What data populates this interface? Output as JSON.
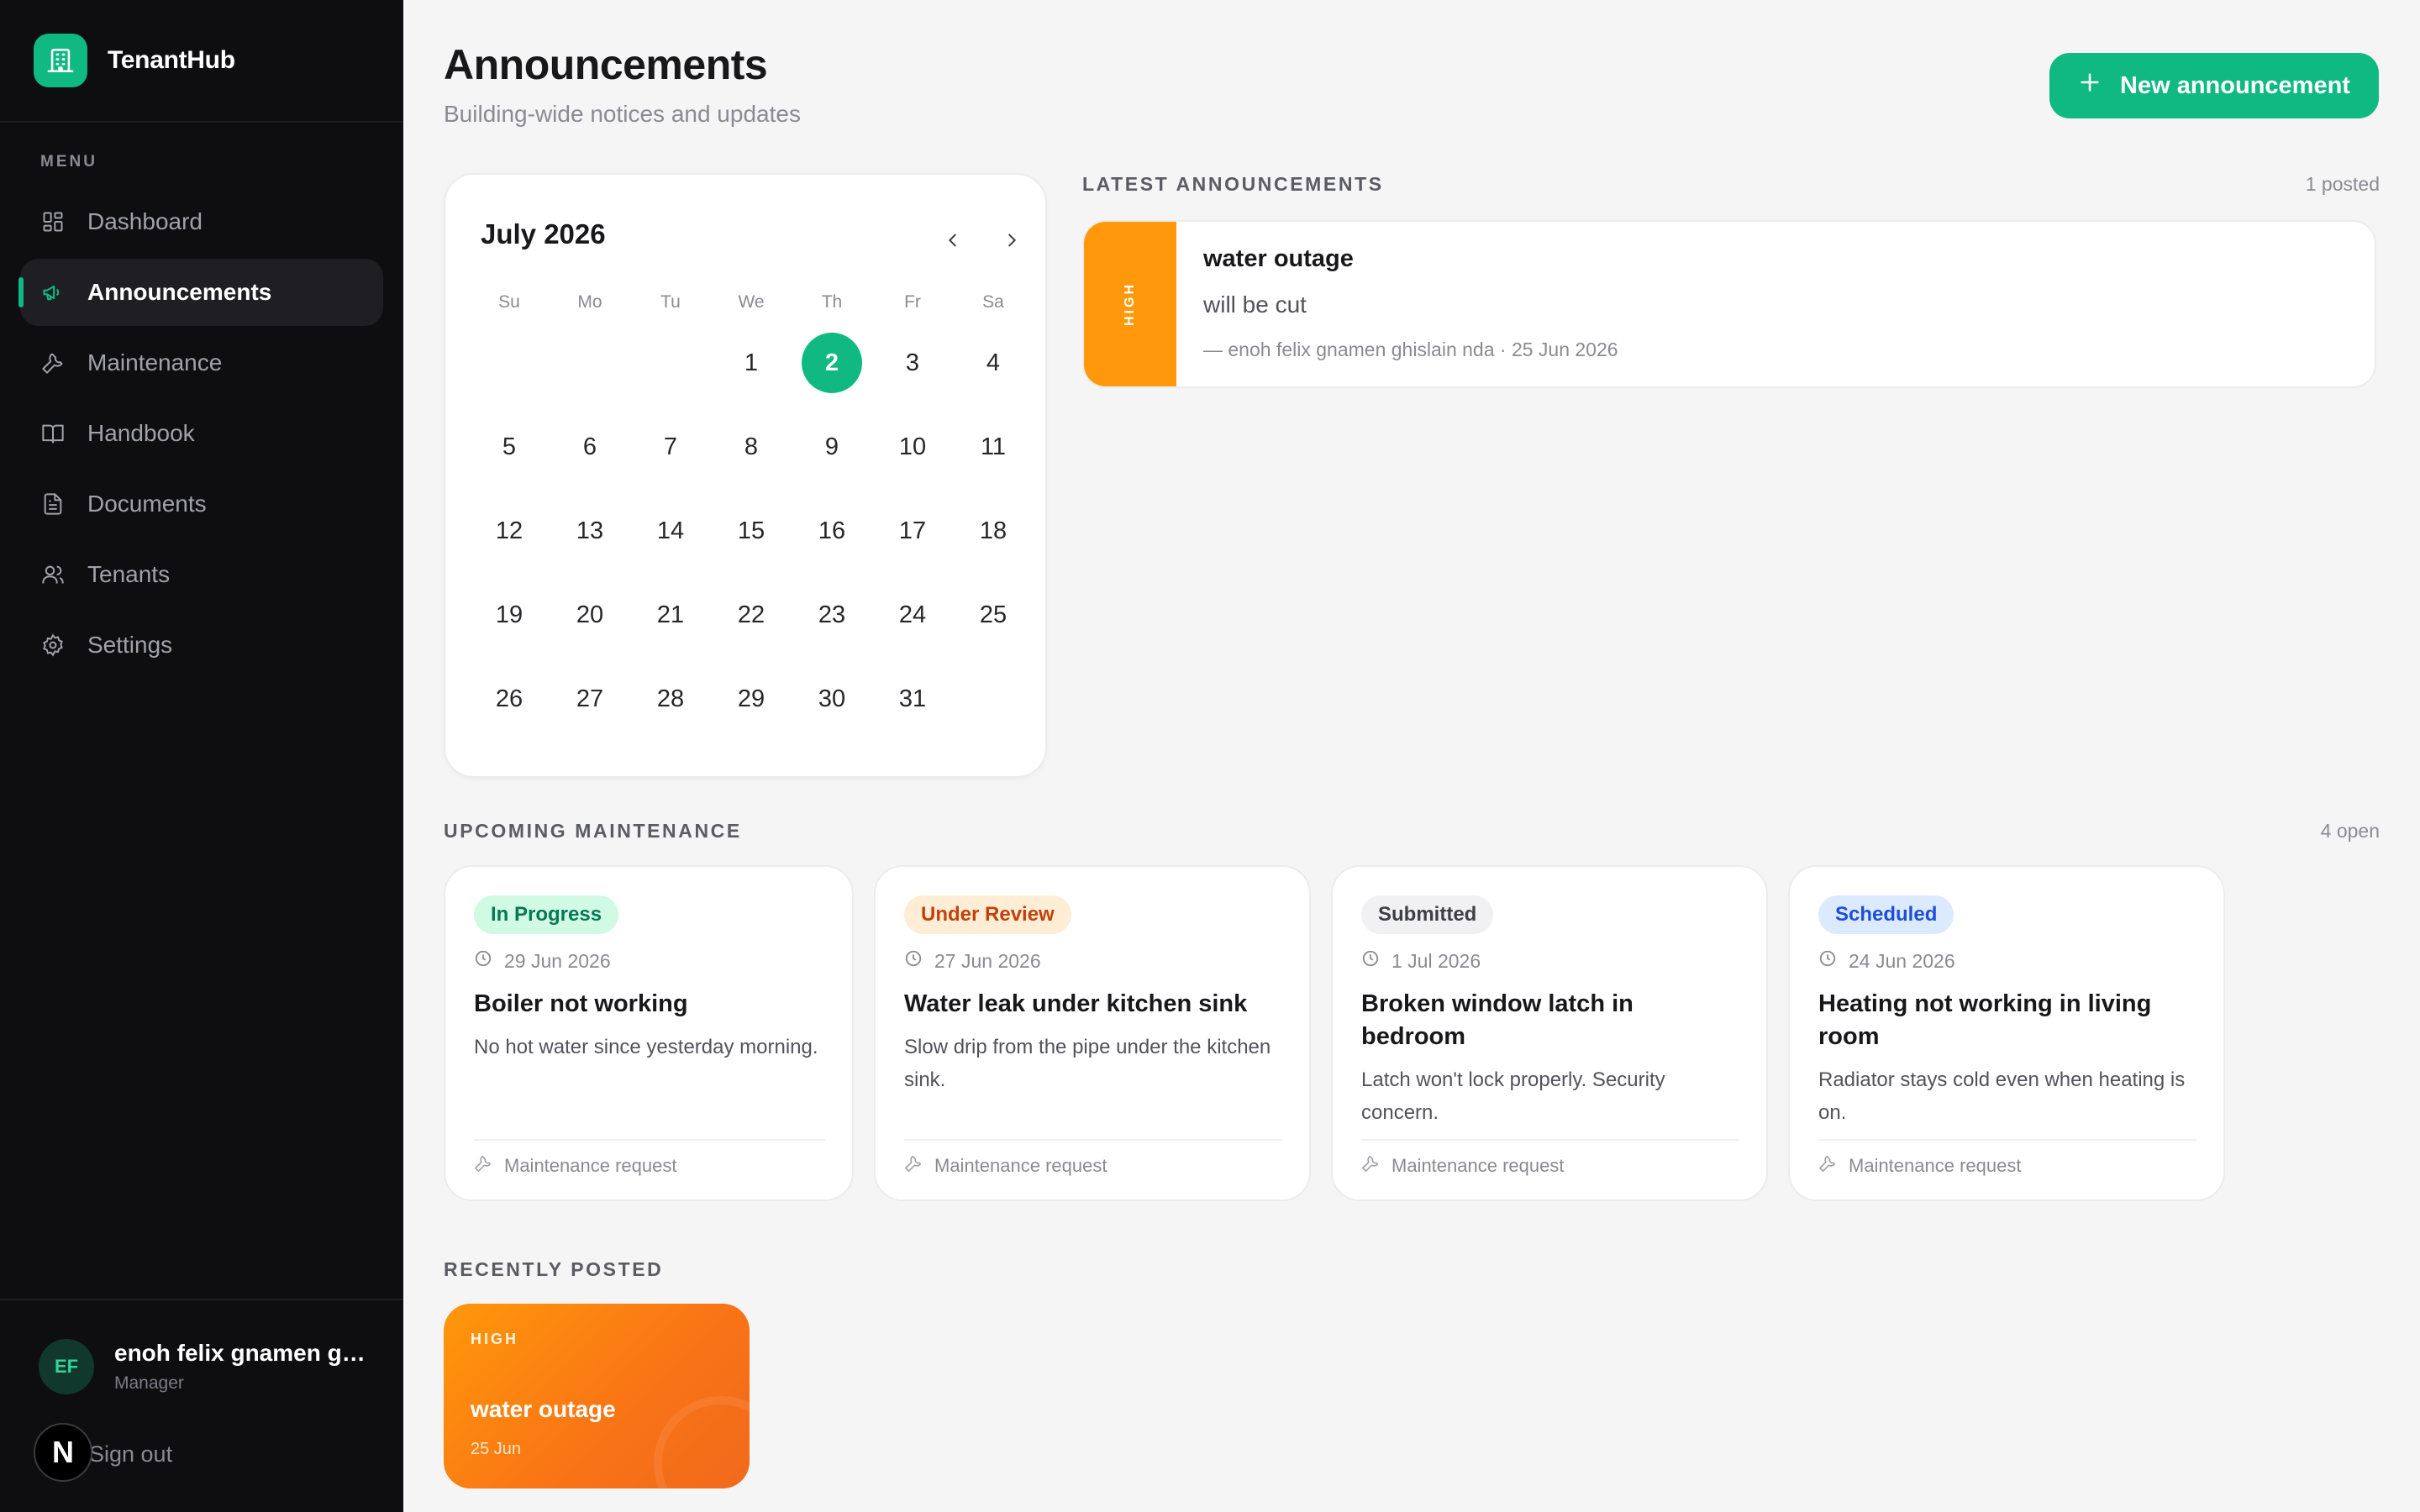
{
  "app": {
    "name": "TenantHub"
  },
  "sidebar": {
    "menu_label": "MENU",
    "items": [
      {
        "label": "Dashboard",
        "icon": "dashboard-icon",
        "active": false
      },
      {
        "label": "Announcements",
        "icon": "megaphone-icon",
        "active": true
      },
      {
        "label": "Maintenance",
        "icon": "wrench-icon",
        "active": false
      },
      {
        "label": "Handbook",
        "icon": "book-icon",
        "active": false
      },
      {
        "label": "Documents",
        "icon": "document-icon",
        "active": false
      },
      {
        "label": "Tenants",
        "icon": "users-icon",
        "active": false
      },
      {
        "label": "Settings",
        "icon": "gear-icon",
        "active": false
      }
    ],
    "user": {
      "initials": "EF",
      "name": "enoh felix gnamen ghislain nda",
      "role": "Manager"
    },
    "sign_out": "Sign out",
    "badge": "N"
  },
  "header": {
    "title": "Announcements",
    "subtitle": "Building-wide notices and updates",
    "new_button": "New announcement"
  },
  "calendar": {
    "month_label": "July 2026",
    "weekdays": [
      "Su",
      "Mo",
      "Tu",
      "We",
      "Th",
      "Fr",
      "Sa"
    ],
    "leading_blanks": 3,
    "days_in_month": 31,
    "today": 2
  },
  "latest": {
    "label": "LATEST ANNOUNCEMENTS",
    "count": "1 posted",
    "items": [
      {
        "priority": "HIGH",
        "title": "water outage",
        "body": "will be cut",
        "meta": "— enoh felix gnamen ghislain nda · 25 Jun 2026"
      }
    ]
  },
  "maintenance": {
    "label": "UPCOMING MAINTENANCE",
    "count": "4 open",
    "footer": "Maintenance request",
    "items": [
      {
        "status": "In Progress",
        "date": "29 Jun 2026",
        "title": "Boiler not working",
        "desc": "No hot water since yesterday morning."
      },
      {
        "status": "Under Review",
        "date": "27 Jun 2026",
        "title": "Water leak under kitchen sink",
        "desc": "Slow drip from the pipe under the kitchen sink."
      },
      {
        "status": "Submitted",
        "date": "1 Jul 2026",
        "title": "Broken window latch in bedroom",
        "desc": "Latch won't lock properly. Security concern."
      },
      {
        "status": "Scheduled",
        "date": "24 Jun 2026",
        "title": "Heating not working in living room",
        "desc": "Radiator stays cold even when heating is on."
      }
    ]
  },
  "recent": {
    "label": "RECENTLY POSTED",
    "items": [
      {
        "priority": "HIGH",
        "title": "water outage",
        "date": "25 Jun"
      }
    ]
  },
  "colors": {
    "accent": "#10b981",
    "sidebar_bg": "#0e0e10",
    "priority_high": "#ff980a",
    "status_in_progress": "#d1fae5",
    "status_under_review": "#ffedd5",
    "status_submitted": "#f1f1f3",
    "status_scheduled": "#dbeafe"
  }
}
